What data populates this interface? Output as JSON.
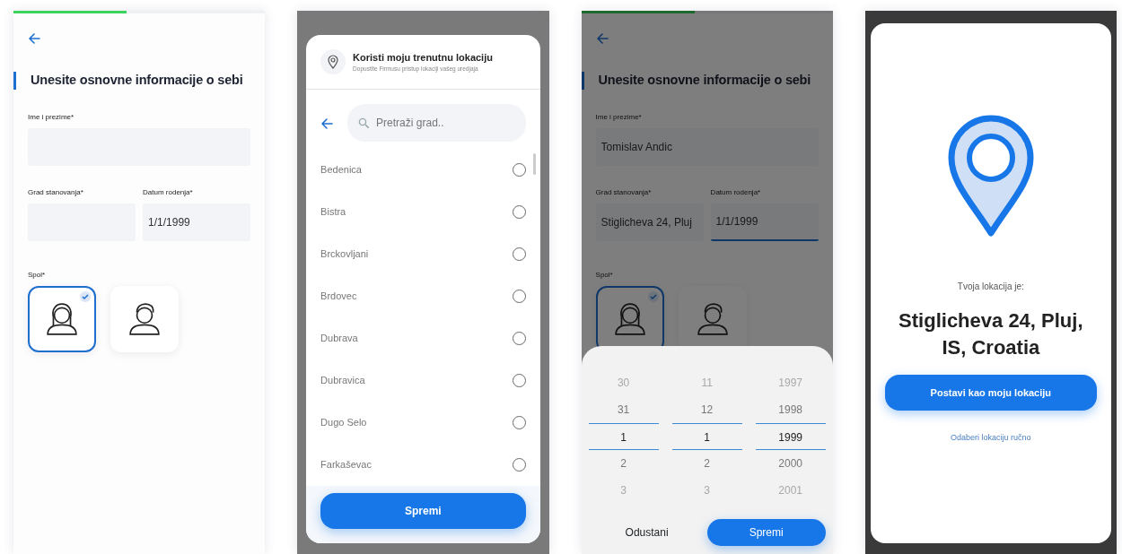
{
  "screens": [
    {
      "kind": "form",
      "progress": {
        "level": 0.45
      },
      "title": "Unesite osnovne informacije o sebi",
      "fields": [
        {
          "label": "Ime i prezime*",
          "focused": false
        },
        {
          "label": "Grad stanovanja*",
          "focused": false
        },
        {
          "label": "Datum rodenja*",
          "value": "1/1/1999",
          "focused": false
        }
      ],
      "gender": {
        "label": "Spol*",
        "options": [
          {
            "kind": "female",
            "selected": true
          },
          {
            "kind": "male",
            "selected": false
          }
        ]
      }
    },
    {
      "kind": "city_picker",
      "location_option": {
        "title": "Koristi moju trenutnu lokaciju",
        "subtitle": "Dopustite Firmusu pristup lokaciji vašeg uredjaja"
      },
      "search": {
        "placeholder": "Pretraži grad.."
      },
      "cities": [
        {
          "name": "Bedenica",
          "selected": false
        },
        {
          "name": "Bistra",
          "selected": false
        },
        {
          "name": "Brckovljani",
          "selected": false
        },
        {
          "name": "Brdovec",
          "selected": false
        },
        {
          "name": "Dubrava",
          "selected": false
        },
        {
          "name": "Dubravica",
          "selected": false
        },
        {
          "name": "Dugo Selo",
          "selected": false
        },
        {
          "name": "Farkaševac",
          "selected": false
        }
      ],
      "save_button": "Spremi"
    },
    {
      "kind": "form",
      "progress": {
        "level": 0.45
      },
      "title": "Unesite osnovne informacije o sebi",
      "fields": [
        {
          "label": "Ime i prezime*",
          "value": "Tomislav Andic",
          "focused": false
        },
        {
          "label": "Grad stanovanja*",
          "value": "Stiglicheva 24, Pluj",
          "focused": false
        },
        {
          "label": "Datum rodenja*",
          "value": "1/1/1999",
          "focused": true
        }
      ],
      "gender": {
        "label": "Spol*",
        "options": [
          {
            "kind": "female",
            "selected": true
          },
          {
            "kind": "male",
            "selected": false
          }
        ]
      },
      "date_picker": {
        "columns": [
          {
            "items": [
              {
                "text": "30",
                "selected": false
              },
              {
                "text": "31",
                "selected": false
              },
              {
                "text": "1",
                "selected": true
              },
              {
                "text": "2",
                "selected": false
              },
              {
                "text": "3",
                "selected": false
              }
            ]
          },
          {
            "items": [
              {
                "text": "11",
                "selected": false
              },
              {
                "text": "12",
                "selected": false
              },
              {
                "text": "1",
                "selected": true
              },
              {
                "text": "2",
                "selected": false
              },
              {
                "text": "3",
                "selected": false
              }
            ]
          },
          {
            "items": [
              {
                "text": "1997",
                "selected": false
              },
              {
                "text": "1998",
                "selected": false
              },
              {
                "text": "1999",
                "selected": true
              },
              {
                "text": "2000",
                "selected": false
              },
              {
                "text": "2001",
                "selected": false
              }
            ]
          }
        ],
        "cancel_button": "Odustani",
        "save_button": "Spremi"
      }
    },
    {
      "kind": "location",
      "caption": "Tvoja lokacija je:",
      "address": "Stiglicheva 24, Pluj, IS, Croatia",
      "confirm_button": "Postavi kao moju lokaciju",
      "manual_link": "Odaberi lokaciju ručno"
    }
  ]
}
